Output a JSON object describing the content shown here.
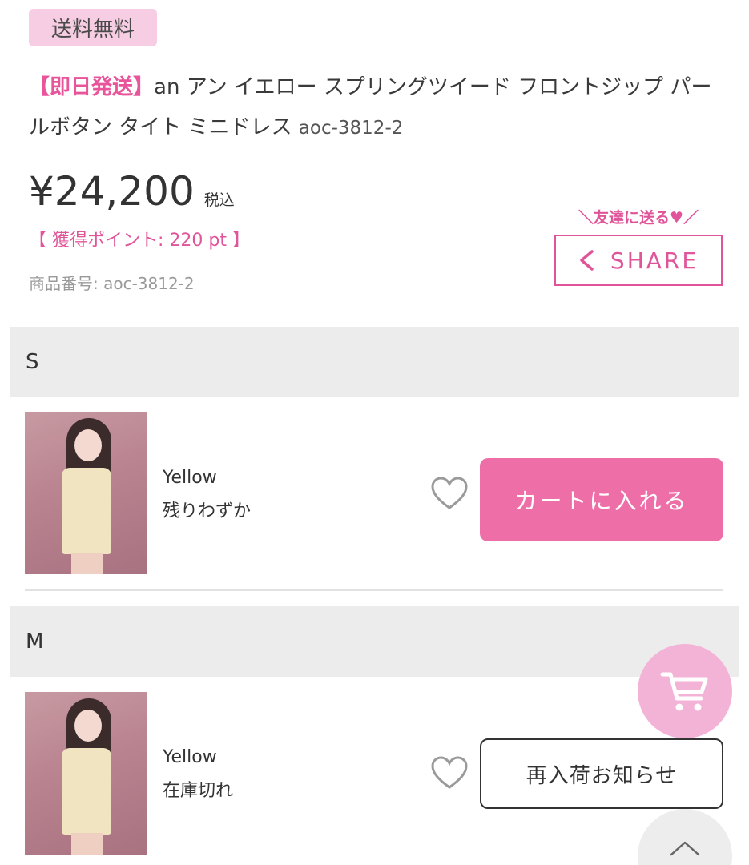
{
  "badge": {
    "label": "送料無料"
  },
  "product": {
    "tag": "【即日発送】",
    "title": "an アン イエロー スプリングツイード フロントジップ パールボタン タイト ミニドレス",
    "sku_inline": "aoc-3812-2",
    "price": "¥24,200",
    "tax_label": "税込",
    "points": "【 獲得ポイント: 220 pt 】",
    "product_number": "商品番号: aoc-3812-2"
  },
  "share": {
    "send_label": "＼友達に送る♥／",
    "button_label": "SHARE"
  },
  "sizes": [
    {
      "size": "S",
      "color": "Yellow",
      "stock": "残りわずか",
      "action": "カートに入れる"
    },
    {
      "size": "M",
      "color": "Yellow",
      "stock": "在庫切れ",
      "action": "再入荷お知らせ"
    }
  ],
  "icons": {
    "share": "share-icon",
    "heart": "heart-icon",
    "cart": "cart-icon",
    "scroll_top": "chevron-up-icon"
  },
  "colors": {
    "accent": "#e0559a",
    "cart_button": "#ee6fa8",
    "badge_bg": "#f6cde2",
    "floating_cart": "#f3b3d6"
  }
}
